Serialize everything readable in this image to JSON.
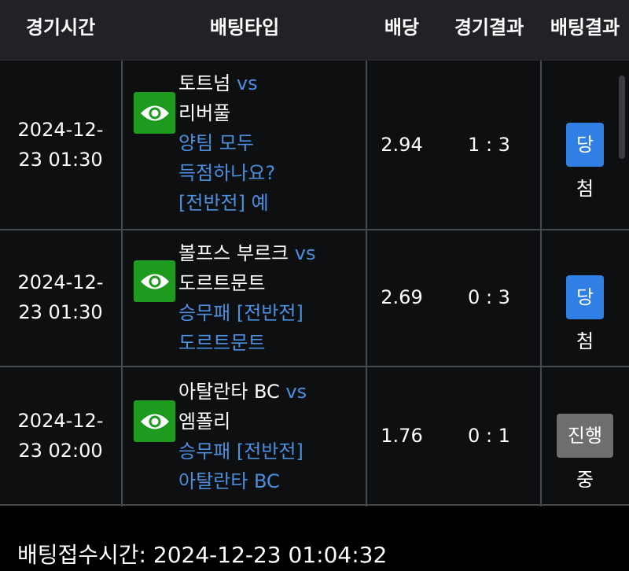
{
  "header": {
    "col_time": "경기시간",
    "col_type": "배팅타입",
    "col_odds": "배당",
    "col_result": "경기결과",
    "col_bet_result": "배팅결과"
  },
  "rows": [
    {
      "time_line1": "2024-12-",
      "time_line2": "23 01:30",
      "home": "토트넘",
      "vs": "vs",
      "away": "리버풀",
      "market_line1": "양팀 모두",
      "market_line2": "득점하나요?",
      "market_line3": "[전반전] 예",
      "odds": "2.94",
      "score": "1 : 3",
      "status": "당첨",
      "status_color": "#2f7fe4"
    },
    {
      "time_line1": "2024-12-",
      "time_line2": "23 01:30",
      "home": "볼프스 부르크",
      "vs": "vs",
      "away": "도르트문트",
      "market_line1": "승무패 [전반전]",
      "market_line2": "도르트문트",
      "odds": "2.69",
      "score": "0 : 3",
      "status": "당첨",
      "status_color": "#2f7fe4"
    },
    {
      "time_line1": "2024-12-",
      "time_line2": "23 02:00",
      "home": "아탈란타 BC",
      "vs": "vs",
      "away": "엠폴리",
      "market_line1": "승무패 [전반전]",
      "market_line2": "아탈란타 BC",
      "odds": "1.76",
      "score": "0 : 1",
      "status": "진행중",
      "status_color": "#6e6e6e"
    }
  ],
  "icons": {
    "view": "eye-icon"
  },
  "footer": {
    "label": "배팅접수시간: 2024-12-23 01:04:32"
  }
}
